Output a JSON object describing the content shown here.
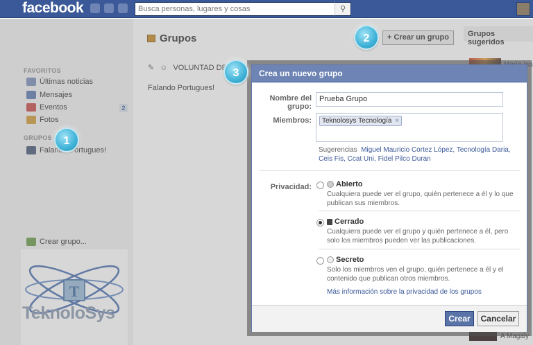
{
  "topbar": {
    "logo": "facebook",
    "search_placeholder": "Busca personas, lugares y cosas"
  },
  "sidebar": {
    "favorites_heading": "FAVORITOS",
    "items": [
      {
        "label": "Últimas noticias",
        "icon": "news-feed-icon"
      },
      {
        "label": "Mensajes",
        "icon": "messages-icon"
      },
      {
        "label": "Eventos",
        "icon": "events-icon",
        "badge": "2"
      },
      {
        "label": "Fotos",
        "icon": "photos-icon"
      }
    ],
    "groups_heading": "GRUPOS",
    "group_item": "Falando Portugues!",
    "create_group": "Crear grupo..."
  },
  "branding": {
    "logo_text": "TeknoloSys"
  },
  "main": {
    "title": "Grupos",
    "create_group_button": "+ Crear un grupo",
    "suggested_heading": "Grupos sugeridos",
    "rows": [
      {
        "label": "VOLUNTAD DE"
      },
      {
        "label": "Falando Portugues!"
      }
    ]
  },
  "steps": [
    "1",
    "2",
    "3"
  ],
  "dialog": {
    "title": "Crea un nuevo grupo",
    "name_label": "Nombre del grupo:",
    "name_value": "Prueba Grupo",
    "members_label": "Miembros:",
    "member_token": "Teknolosys Tecnología",
    "suggestions_label": "Sugerencias",
    "suggestions": "Miguel Mauricio Cortez López, Tecnología Daria, Ceis Fis, Ccat Uni, Fidel Pilco Duran",
    "privacy_label": "Privacidad:",
    "options": [
      {
        "title": "Abierto",
        "desc": "Cualquiera puede ver el grupo, quién pertenece a él y lo que publican sus miembros.",
        "selected": false
      },
      {
        "title": "Cerrado",
        "desc": "Cualquiera puede ver el grupo y quién pertenece a él, pero solo los miembros pueden ver las publicaciones.",
        "selected": true
      },
      {
        "title": "Secreto",
        "desc": "Solo los miembros ven el grupo, quién pertenece a él y el contenido que publican otros miembros.",
        "selected": false
      }
    ],
    "more_info": "Más información sobre la privacidad de los grupos",
    "create_button": "Crear",
    "cancel_button": "Cancelar"
  },
  "right_snippets": [
    "María Isa",
    "A Magaly"
  ]
}
